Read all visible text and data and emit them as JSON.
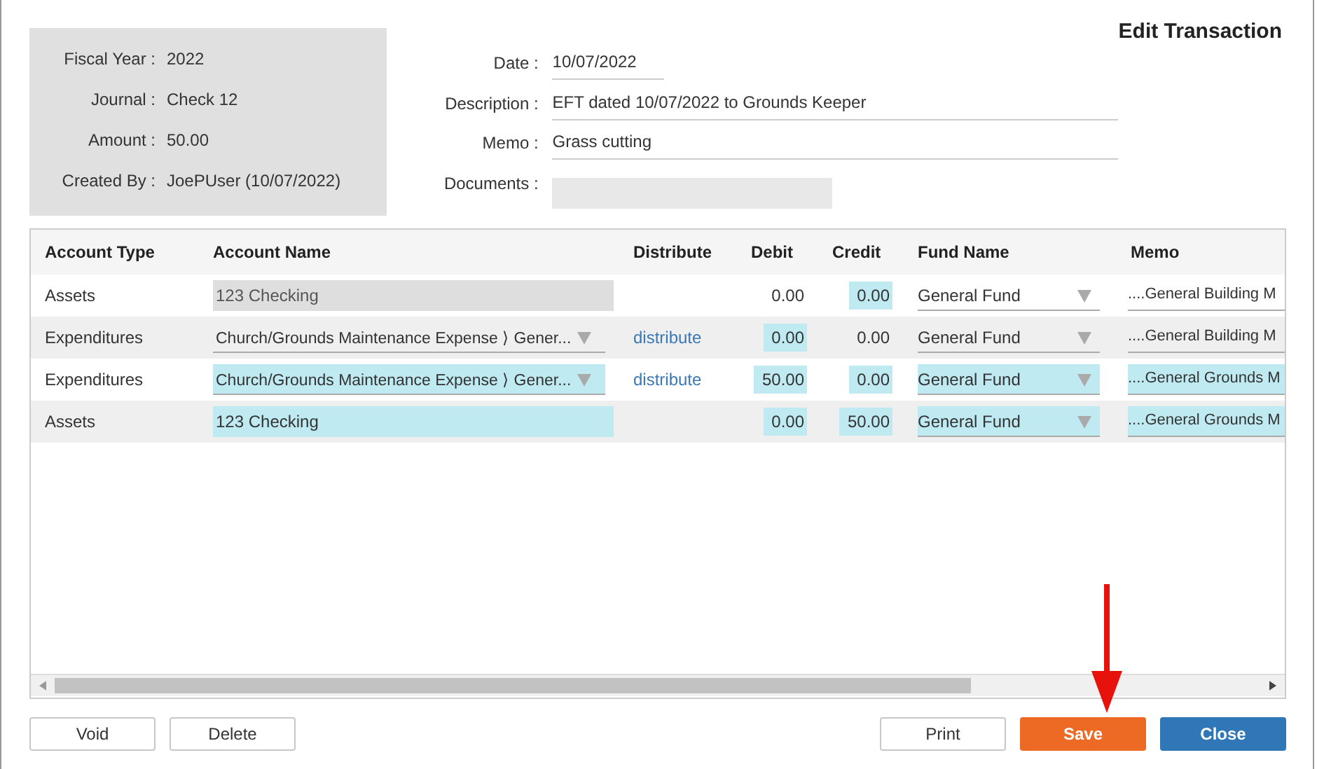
{
  "title": "Edit Transaction",
  "info": [
    {
      "label": "Fiscal Year :",
      "value": "2022"
    },
    {
      "label": "Journal :",
      "value": "Check 12"
    },
    {
      "label": "Amount :",
      "value": "50.00"
    },
    {
      "label": "Created By :",
      "value": "JoePUser (10/07/2022)"
    }
  ],
  "form": [
    {
      "label": "Date :",
      "value": "10/07/2022",
      "kind": "short"
    },
    {
      "label": "Description :",
      "value": "EFT dated 10/07/2022 to Grounds Keeper",
      "kind": "long"
    },
    {
      "label": "Memo :",
      "value": "Grass cutting",
      "kind": "long"
    },
    {
      "label": "Documents :",
      "kind": "attach"
    }
  ],
  "table": {
    "columns": [
      "Account Type",
      "Account Name",
      "Distribute",
      "Debit",
      "Credit",
      "Fund Name",
      "Memo"
    ],
    "rows": [
      {
        "account_type": "Assets",
        "account_name": {
          "text": "123 Checking",
          "kind": "readonly",
          "highlighted": false
        },
        "distribute": null,
        "debit": {
          "text": "0.00",
          "highlighted": false
        },
        "credit": {
          "text": "0.00",
          "highlighted": true
        },
        "fund": {
          "text": "General Fund",
          "highlighted": false
        },
        "memo": {
          "text": "....General Building M",
          "highlighted": false
        }
      },
      {
        "account_type": "Expenditures",
        "account_name": {
          "text": "Church/Grounds Maintenance Expense ⟩ Gener...",
          "kind": "select",
          "highlighted": false
        },
        "distribute": "distribute",
        "debit": {
          "text": "0.00",
          "highlighted": true
        },
        "credit": {
          "text": "0.00",
          "highlighted": false
        },
        "fund": {
          "text": "General Fund",
          "highlighted": false
        },
        "memo": {
          "text": "....General Building M",
          "highlighted": false
        }
      },
      {
        "account_type": "Expenditures",
        "account_name": {
          "text": "Church/Grounds Maintenance Expense ⟩ Gener...",
          "kind": "select",
          "highlighted": true
        },
        "distribute": "distribute",
        "debit": {
          "text": "50.00",
          "highlighted": true
        },
        "credit": {
          "text": "0.00",
          "highlighted": true
        },
        "fund": {
          "text": "General Fund",
          "highlighted": true
        },
        "memo": {
          "text": "....General Grounds M",
          "highlighted": true
        }
      },
      {
        "account_type": "Assets",
        "account_name": {
          "text": "123 Checking",
          "kind": "text",
          "highlighted": true
        },
        "distribute": null,
        "debit": {
          "text": "0.00",
          "highlighted": true
        },
        "credit": {
          "text": "50.00",
          "highlighted": true
        },
        "fund": {
          "text": "General Fund",
          "highlighted": true
        },
        "memo": {
          "text": "....General Grounds M",
          "highlighted": true
        }
      }
    ]
  },
  "buttons_left": [
    "Void",
    "Delete"
  ],
  "buttons_right": [
    {
      "label": "Print",
      "kind": "plain"
    },
    {
      "label": "Save",
      "kind": "save"
    },
    {
      "label": "Close",
      "kind": "primary"
    }
  ]
}
